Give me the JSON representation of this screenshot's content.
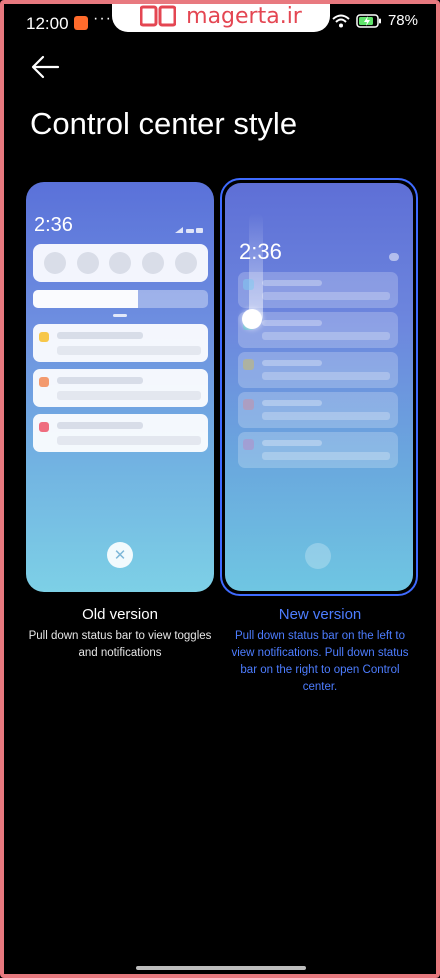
{
  "status_bar": {
    "time": "12:00",
    "dots": "···",
    "battery_percent": "78%"
  },
  "watermark": {
    "text": "magerta.ir"
  },
  "header": {
    "title": "Control center style"
  },
  "old_card": {
    "phone_time": "2:36",
    "brightness_level": 0.6,
    "notification_dot_colors": [
      "#f7c74a",
      "#f39a6e",
      "#ef6d7f"
    ],
    "close_glyph": "✕"
  },
  "new_card": {
    "phone_time": "2:36",
    "notification_dot_colors": [
      "#7fc9f0",
      "#4fd1c0",
      "#c9b96a",
      "#c890a6",
      "#b58cc6"
    ]
  },
  "options": {
    "old": {
      "title": "Old version",
      "description": "Pull down status bar to view toggles and notifications"
    },
    "new": {
      "title": "New version",
      "description": "Pull down status bar on the left to view notifications. Pull down status bar on the right to open Control center."
    }
  },
  "colors": {
    "accent": "#4d7dff",
    "selected_border": "#3f6bff",
    "frame": "#e8797f"
  }
}
